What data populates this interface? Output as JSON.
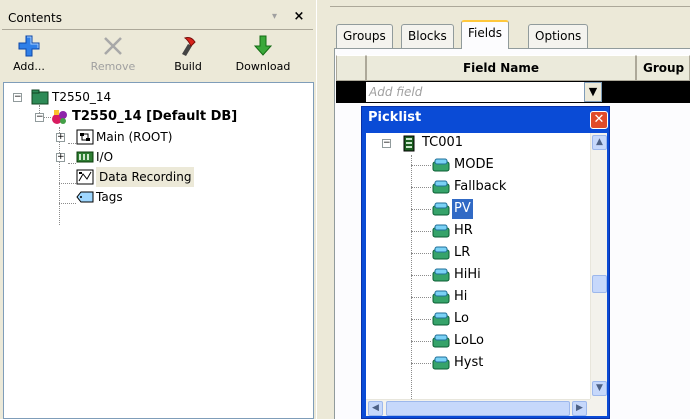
{
  "contents_panel": {
    "title": "Contents",
    "pin_glyph": "▾",
    "close_glyph": "×",
    "toolbar": [
      {
        "label": "Add...",
        "icon": "add-icon",
        "enabled": true
      },
      {
        "label": "Remove",
        "icon": "remove-icon",
        "enabled": false
      },
      {
        "label": "Build",
        "icon": "build-icon",
        "enabled": true
      },
      {
        "label": "Download",
        "icon": "download-icon",
        "enabled": true
      }
    ],
    "tree": {
      "root": "T2550_14",
      "db": "T2550_14 [Default DB]",
      "items": [
        "Main (ROOT)",
        "I/O",
        "Data Recording",
        "Tags"
      ]
    }
  },
  "tabs": [
    "Groups",
    "Blocks",
    "Fields",
    "Options"
  ],
  "active_tab": "Fields",
  "grid": {
    "columns": [
      "Field Name",
      "Group"
    ],
    "add_placeholder": "Add field",
    "dropdown_glyph": "▼"
  },
  "picklist": {
    "title": "Picklist",
    "close_glyph": "✕",
    "block": "TC001",
    "fields": [
      "MODE",
      "Fallback",
      "PV",
      "HR",
      "LR",
      "HiHi",
      "Hi",
      "Lo",
      "LoLo",
      "Hyst"
    ],
    "selected": "PV"
  },
  "colors": {
    "titlebar_blue": "#0a4bd6",
    "selection_blue": "#316ac5",
    "active_tab_accent": "#ffc83c"
  }
}
